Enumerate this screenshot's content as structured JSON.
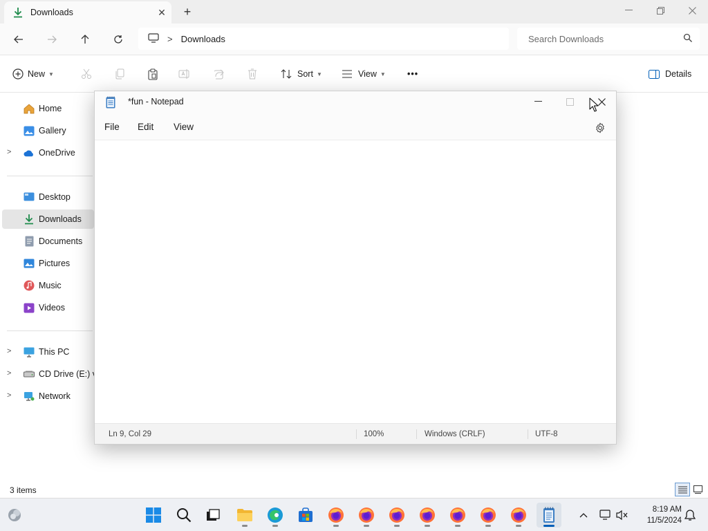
{
  "explorer": {
    "tab": {
      "label": "Downloads",
      "close": "✕"
    },
    "new_tab": "+",
    "window_controls": {
      "minimize": "—",
      "maximize": "▢",
      "close": "✕"
    },
    "address": {
      "crumb": "Downloads",
      "separator": ">"
    },
    "search": {
      "placeholder": "Search Downloads"
    },
    "commands": {
      "new": "New",
      "sort": "Sort",
      "view": "View",
      "more": "•••",
      "details": "Details"
    },
    "nav": {
      "quick": [
        {
          "label": "Home",
          "icon": "home-icon"
        },
        {
          "label": "Gallery",
          "icon": "gallery-icon"
        },
        {
          "label": "OneDrive",
          "icon": "onedrive-icon"
        }
      ],
      "folders": [
        {
          "label": "Desktop",
          "icon": "desktop-icon"
        },
        {
          "label": "Downloads",
          "icon": "downloads-icon",
          "selected": true
        },
        {
          "label": "Documents",
          "icon": "documents-icon"
        },
        {
          "label": "Pictures",
          "icon": "pictures-icon"
        },
        {
          "label": "Music",
          "icon": "music-icon"
        },
        {
          "label": "Videos",
          "icon": "videos-icon"
        }
      ],
      "drives": [
        {
          "label": "This PC",
          "icon": "this-pc-icon"
        },
        {
          "label": "CD Drive (E:) vir",
          "icon": "cd-drive-icon"
        },
        {
          "label": "Network",
          "icon": "network-icon"
        }
      ]
    },
    "status": {
      "items": "3 items"
    }
  },
  "notepad": {
    "title": "*fun - Notepad",
    "menu": {
      "file": "File",
      "edit": "Edit",
      "view": "View"
    },
    "status": {
      "position": "Ln 9, Col 29",
      "zoom": "100%",
      "line_endings": "Windows (CRLF)",
      "encoding": "UTF-8"
    }
  },
  "taskbar": {
    "time": "8:19 AM",
    "date": "11/5/2024",
    "firefox_count": 7
  },
  "colors": {
    "accent": "#005fb8",
    "download_green": "#1f8b4c"
  }
}
